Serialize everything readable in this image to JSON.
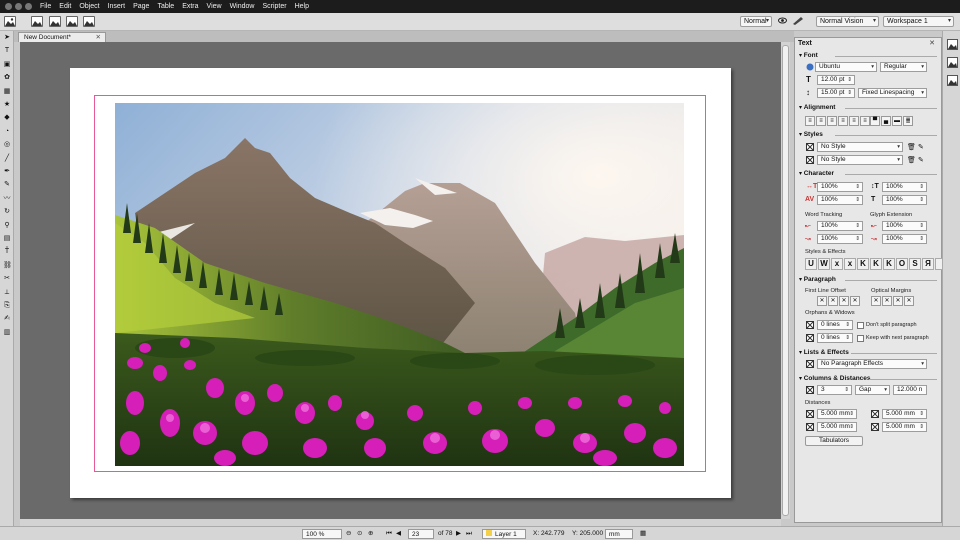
{
  "menu": [
    "File",
    "Edit",
    "Object",
    "Insert",
    "Page",
    "Table",
    "Extra",
    "View",
    "Window",
    "Scripter",
    "Help"
  ],
  "toolbar": {
    "mode": "Normal",
    "vision": "Normal Vision",
    "workspace": "Workspace 1"
  },
  "document": {
    "tab_title": "New Document*"
  },
  "status": {
    "zoom": "100 %",
    "page_current": "23",
    "page_total": "of 78",
    "layer": "Layer 1",
    "x": "X: 242.779",
    "y": "Y: 205.000",
    "unit": "mm"
  },
  "panel": {
    "title": "Text",
    "font": {
      "heading": "Font",
      "family": "Ubuntu",
      "style": "Regular",
      "size": "12.00 pt",
      "line_spacing": "15.00 pt",
      "line_spacing_mode": "Fixed Linespacing"
    },
    "alignment": {
      "heading": "Alignment"
    },
    "styles": {
      "heading": "Styles",
      "paragraph_style": "No Style",
      "character_style": "No Style"
    },
    "character": {
      "heading": "Character",
      "scale_h": "100%",
      "scale_v": "100%",
      "kerning": "100%",
      "baseline": "100%",
      "word_tracking_label": "Word Tracking",
      "glyph_extension_label": "Glyph Extension",
      "wt_min": "100%",
      "wt_norm": "100%",
      "ge_min": "100%",
      "ge_max": "100%",
      "styles_effects_label": "Styles & Effects"
    },
    "paragraph": {
      "heading": "Paragraph",
      "first_line_offset": "First Line Offset",
      "optical_margins": "Optical Margins",
      "orphans_widows": "Orphans & Widows",
      "lines1": "0 lines",
      "lines2": "0 lines",
      "dont_split": "Don't split paragraph",
      "keep_next": "Keep with next paragraph"
    },
    "lists": {
      "heading": "Lists & Effects",
      "value": "No Paragraph Effects"
    },
    "columns": {
      "heading": "Columns & Distances",
      "count": "3",
      "gap_mode": "Gap",
      "gap_value": "12.000 n",
      "distances_label": "Distances",
      "d_top": "5.000 mm",
      "d_bottom": "5.000 mm",
      "d_left": "5.000 mm",
      "d_right": "5.000 mm",
      "tabulators": "Tabulators"
    }
  },
  "colors": {
    "margin_guide": "#e8599a",
    "workspace": "#6a6a6a",
    "titlebar": "#1c1c1c",
    "flower": "#d61fb8"
  },
  "icons": [
    "select-icon",
    "text-frame-icon",
    "image-frame-icon",
    "render-frame-icon",
    "table-icon",
    "shape-icon",
    "polygon-icon",
    "arc-icon",
    "spiral-icon",
    "line-icon",
    "bezier-icon",
    "freehand-icon",
    "calligraphy-icon",
    "rotate-icon",
    "zoom-icon",
    "edit-contents-icon",
    "edit-text-icon",
    "link-frames-icon",
    "unlink-frames-icon",
    "measure-icon",
    "copy-properties-icon",
    "eyedropper-icon",
    "pdf-field-icon"
  ]
}
